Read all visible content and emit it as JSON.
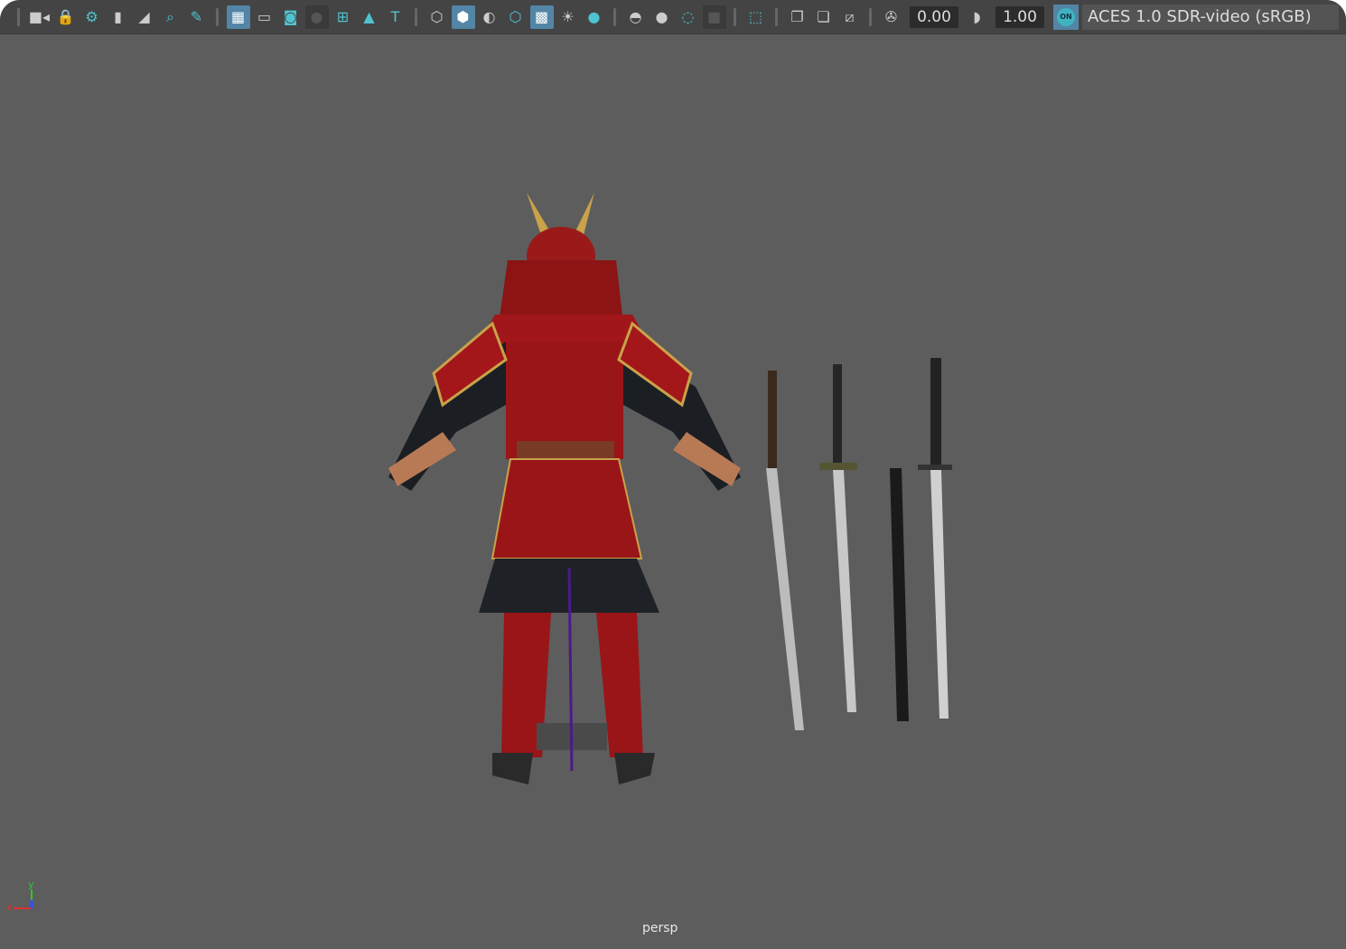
{
  "toolbar": {
    "items": [
      {
        "t": "sep"
      },
      {
        "icon": "camera-icon",
        "g": "■◂"
      },
      {
        "icon": "lock-camera-icon",
        "g": "🔒",
        "c": "teal"
      },
      {
        "icon": "camera-attributes-icon",
        "g": "⚙",
        "c": "teal"
      },
      {
        "icon": "bookmark-icon",
        "g": "▮"
      },
      {
        "icon": "image-plane-icon",
        "g": "◢"
      },
      {
        "icon": "2d-pan-zoom-icon",
        "g": "⌕",
        "c": "teal"
      },
      {
        "icon": "grease-pencil-icon",
        "g": "✎",
        "c": "teal"
      },
      {
        "t": "sep"
      },
      {
        "icon": "grid-icon",
        "g": "▦",
        "s": "active"
      },
      {
        "icon": "film-gate-icon",
        "g": "▭"
      },
      {
        "icon": "resolution-gate-icon",
        "g": "◙",
        "c": "teal"
      },
      {
        "icon": "gate-mask-icon",
        "g": "●",
        "s": "dark"
      },
      {
        "icon": "field-chart-icon",
        "g": "⊞",
        "c": "teal"
      },
      {
        "icon": "safe-action-icon",
        "g": "▲",
        "c": "teal"
      },
      {
        "icon": "safe-title-icon",
        "g": "T",
        "c": "teal"
      },
      {
        "t": "sep"
      },
      {
        "icon": "wireframe-icon",
        "g": "⬡"
      },
      {
        "icon": "smooth-shade-icon",
        "g": "⬢",
        "s": "active"
      },
      {
        "icon": "default-material-icon",
        "g": "◐"
      },
      {
        "icon": "wireframe-on-shaded-icon",
        "g": "⬡",
        "c": "teal"
      },
      {
        "icon": "textured-icon",
        "g": "▩",
        "s": "active"
      },
      {
        "icon": "use-all-lights-icon",
        "g": "☀"
      },
      {
        "icon": "shadows-icon",
        "g": "●",
        "c": "teal"
      },
      {
        "t": "sep"
      },
      {
        "icon": "ambient-occlusion-icon",
        "g": "◓"
      },
      {
        "icon": "motion-blur-icon",
        "g": "●"
      },
      {
        "icon": "anti-aliasing-icon",
        "g": "◌",
        "c": "teal"
      },
      {
        "icon": "depth-of-field-icon",
        "g": "■",
        "s": "dark"
      },
      {
        "t": "sep"
      },
      {
        "icon": "isolate-select-icon",
        "g": "⬚",
        "c": "teal"
      },
      {
        "t": "sep"
      },
      {
        "icon": "xray-icon",
        "g": "❐"
      },
      {
        "icon": "xray-joints-icon",
        "g": "❏"
      },
      {
        "icon": "xray-components-icon",
        "g": "⧄"
      },
      {
        "t": "sep"
      },
      {
        "icon": "exposure-icon",
        "g": "✇"
      }
    ],
    "exposure": "0.00",
    "gamma_icon": "gamma-icon",
    "gamma": "1.00",
    "color_mgmt_toggle": "ON",
    "color_space": "ACES 1.0 SDR-video (sRGB)"
  },
  "viewport": {
    "camera": "persp",
    "axis_x": "x",
    "axis_y": "y",
    "axis_z": "z"
  }
}
